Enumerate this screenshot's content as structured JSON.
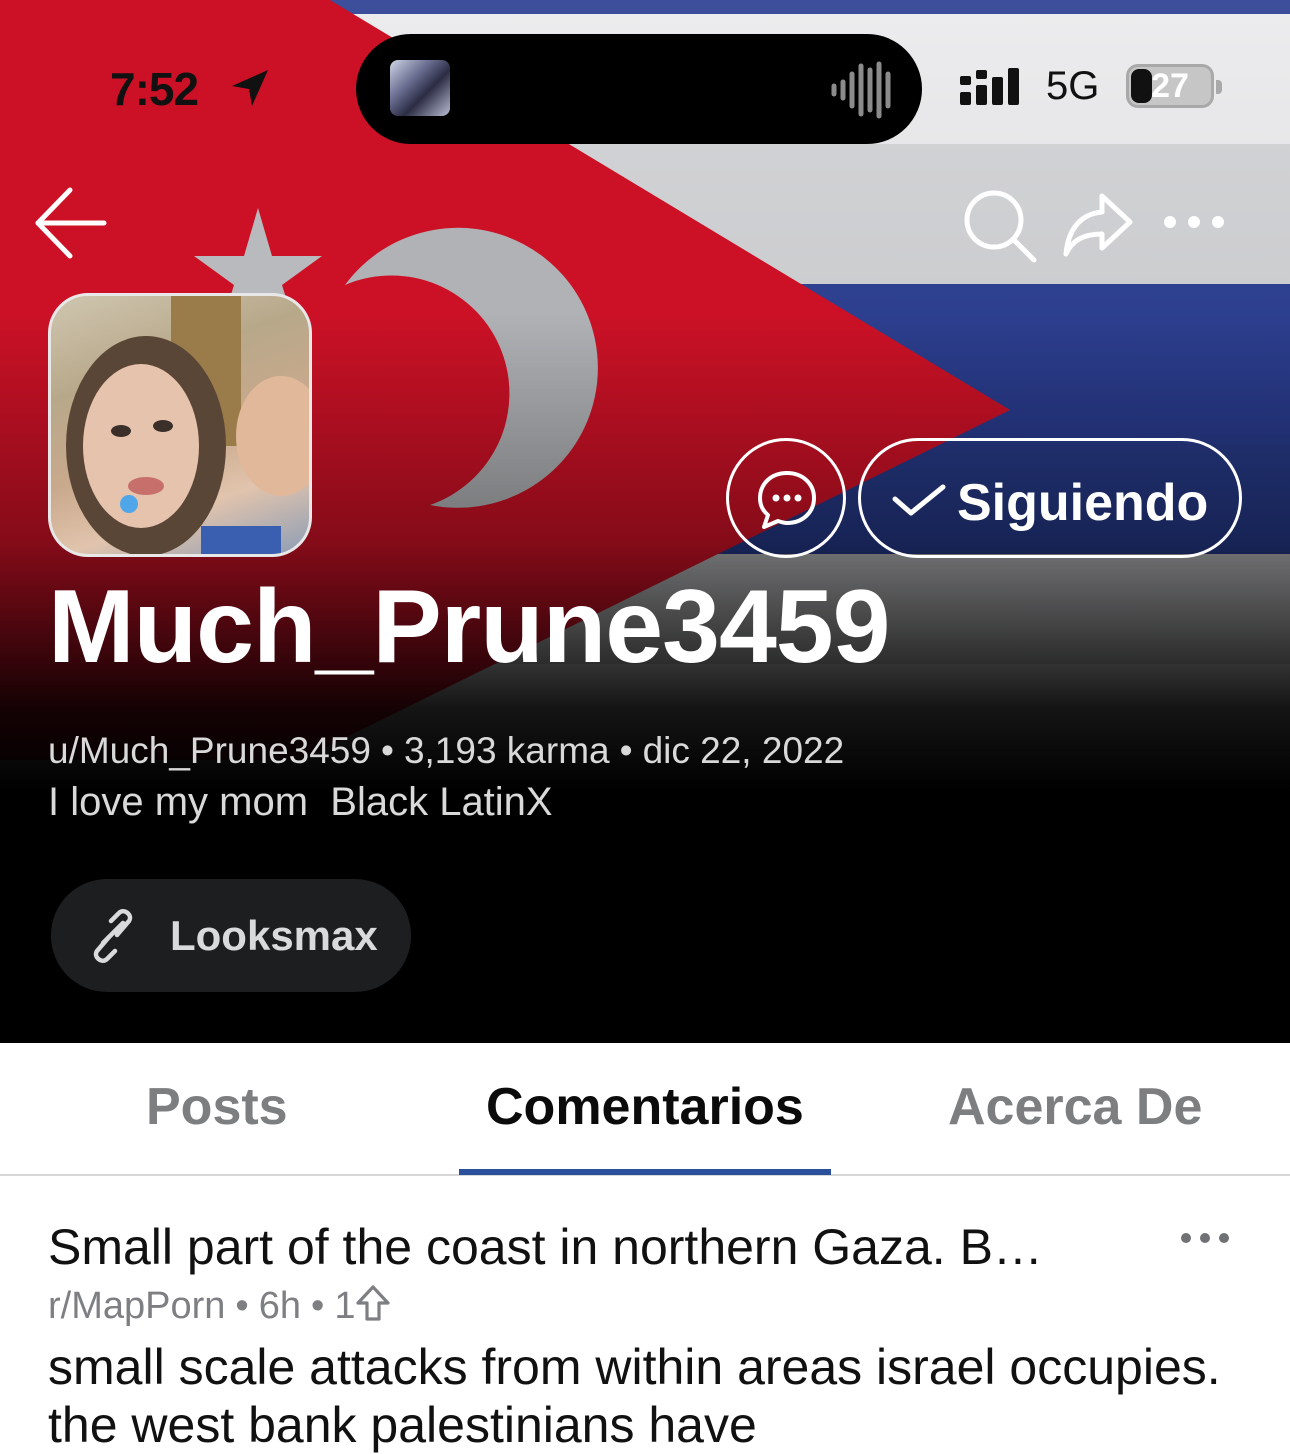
{
  "status_bar": {
    "time": "7:52",
    "network": "5G",
    "battery_level": "27",
    "battery_fraction": 0.27
  },
  "header": {
    "banner": "flag",
    "icons": [
      "back-arrow-icon",
      "search-icon",
      "share-icon",
      "more-icon"
    ]
  },
  "profile": {
    "display_name": "Much_Prune3459",
    "username": "u/Much_Prune3459",
    "karma": "3,193 karma",
    "joined": "dic 22, 2022",
    "bio": "I love my mom  Black LatinX",
    "follow_label": "Siguiendo",
    "link_label": "Looksmax"
  },
  "tabs": [
    {
      "label": "Posts",
      "active": false
    },
    {
      "label": "Comentarios",
      "active": true
    },
    {
      "label": "Acerca De",
      "active": false
    }
  ],
  "comments": [
    {
      "post_title": "Small part of the coast in northern Gaza. B…",
      "subreddit": "r/MapPorn",
      "age": "6h",
      "score": "1",
      "body": "small scale attacks from within areas israel occupies. the west bank palestinians have"
    }
  ],
  "colors": {
    "tab_underline": "#2a4f9b",
    "link_chip_bg": "#1d1e20",
    "flag_red": "#cc1126",
    "flag_blue": "#1b2f8a"
  }
}
